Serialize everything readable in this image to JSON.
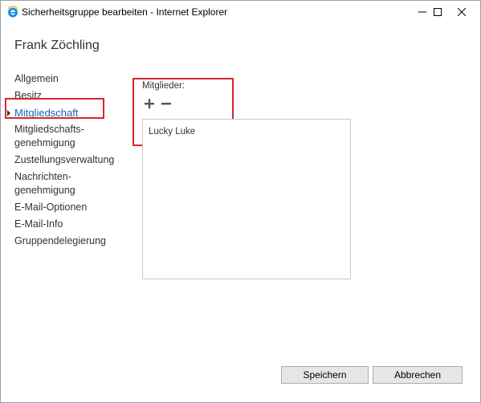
{
  "window": {
    "title": "Sicherheitsgruppe bearbeiten - Internet Explorer",
    "app_icon": "internet-explorer-icon",
    "controls": [
      "minimize-icon",
      "maximize-icon",
      "close-icon"
    ]
  },
  "page": {
    "title": "Frank Zöchling"
  },
  "nav": {
    "items": [
      {
        "label": "Allgemein"
      },
      {
        "label": "Besitz"
      },
      {
        "label": "Mitgliedschaft",
        "active": true
      },
      {
        "label": "Mitgliedschafts-genehmigung"
      },
      {
        "label": "Zustellungsverwaltung"
      },
      {
        "label": "Nachrichten-genehmigung"
      },
      {
        "label": "E-Mail-Optionen"
      },
      {
        "label": "E-Mail-Info"
      },
      {
        "label": "Gruppendelegierung"
      }
    ],
    "label_parts": {
      "mitgliedschafts_1": "Mitgliedschafts-",
      "mitgliedschafts_2": "genehmigung",
      "nachrichten_1": "Nachrichten-",
      "nachrichten_2": "genehmigung"
    }
  },
  "members": {
    "label": "Mitglieder:",
    "add_icon": "plus-icon",
    "remove_icon": "minus-icon",
    "items": [
      "Lucky Luke"
    ]
  },
  "buttons": {
    "save": "Speichern",
    "cancel": "Abbrechen"
  },
  "colors": {
    "active_link": "#1068b9",
    "highlight": "#d9262e",
    "ie_blue": "#1e8fe0",
    "ie_gold": "#f6b93b"
  }
}
